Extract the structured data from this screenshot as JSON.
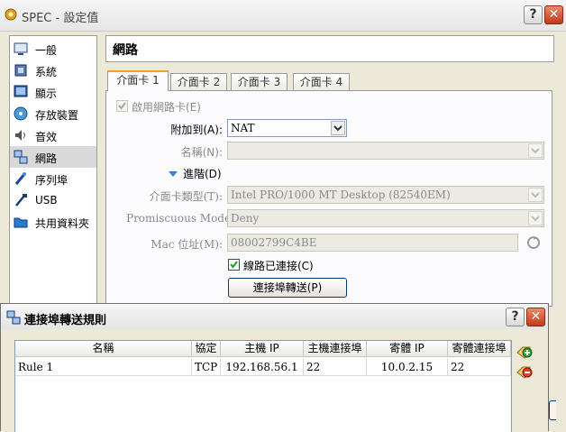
{
  "window": {
    "title": "SPEC - 設定值",
    "help": "?",
    "close": "✕"
  },
  "sidebar": {
    "items": [
      {
        "label": "一般"
      },
      {
        "label": "系統"
      },
      {
        "label": "顯示"
      },
      {
        "label": "存放裝置"
      },
      {
        "label": "音效"
      },
      {
        "label": "網路"
      },
      {
        "label": "序列埠"
      },
      {
        "label": "USB"
      },
      {
        "label": "共用資料夾"
      }
    ],
    "selected_index": 5
  },
  "header": {
    "title": "網路"
  },
  "tabs": [
    {
      "label": "介面卡 1"
    },
    {
      "label": "介面卡 2"
    },
    {
      "label": "介面卡 3"
    },
    {
      "label": "介面卡 4"
    }
  ],
  "adapter": {
    "enable_label": "啟用網路卡(E)",
    "enable_checked": true,
    "attached_label": "附加到(A):",
    "attached_value": "NAT",
    "name_label": "名稱(N):",
    "name_value": "",
    "advanced_label": "進階(D)",
    "type_label": "介面卡類型(T):",
    "type_value": "Intel PRO/1000 MT Desktop (82540EM)",
    "promisc_label": "Promiscuous Mode:",
    "promisc_value": "Deny",
    "mac_label": "Mac 位址(M):",
    "mac_value": "08002799C4BE",
    "cable_label": "線路已連接(C)",
    "cable_checked": true,
    "port_forward_button": "連接埠轉送(P)"
  },
  "dialog": {
    "title": "連接埠轉送規則",
    "help": "?",
    "close": "✕",
    "columns": [
      "名稱",
      "協定",
      "主機 IP",
      "主機連接埠",
      "寄體 IP",
      "寄體連接埠"
    ],
    "rows": [
      [
        "Rule 1",
        "TCP",
        "192.168.56.1",
        "22",
        "10.0.2.15",
        "22"
      ]
    ]
  }
}
